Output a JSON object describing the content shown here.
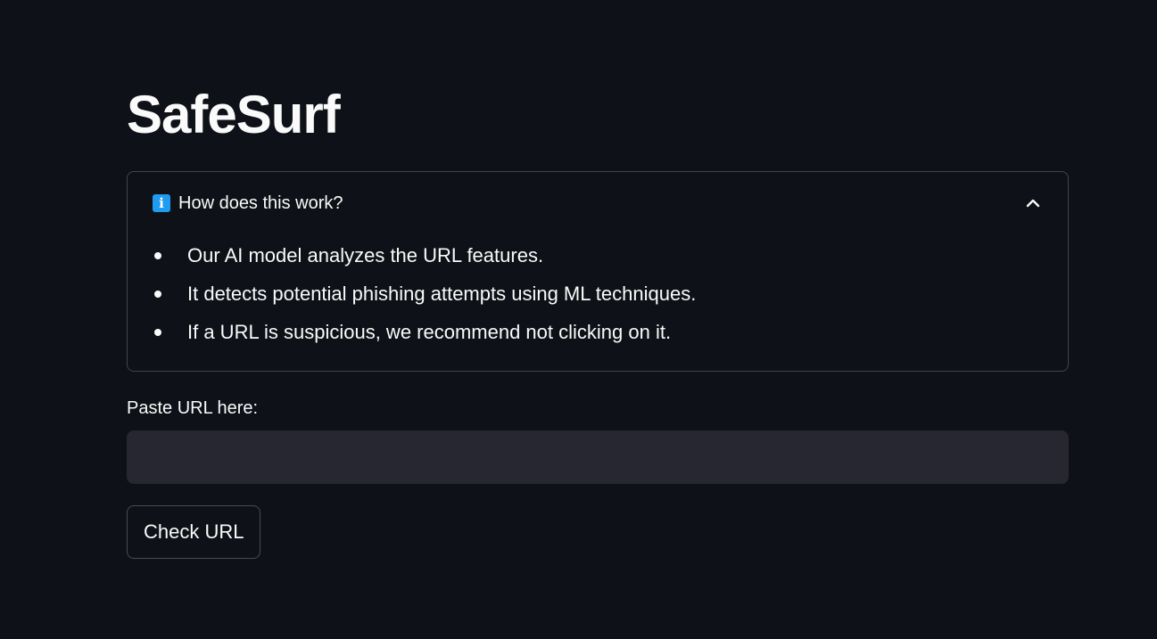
{
  "app": {
    "title": "SafeSurf"
  },
  "expander": {
    "icon": "info-icon",
    "icon_glyph": "i",
    "label": "How does this work?",
    "expanded": true,
    "toggle_icon": "chevron-up-icon",
    "items": [
      {
        "text": "Our AI model analyzes the URL features."
      },
      {
        "text": "It detects potential phishing attempts using ML techniques."
      },
      {
        "text": "If a URL is suspicious, we recommend not clicking on it."
      }
    ]
  },
  "url_field": {
    "label": "Paste URL here:",
    "value": "",
    "placeholder": ""
  },
  "check_button": {
    "label": "Check URL"
  },
  "colors": {
    "background": "#0e1117",
    "input_background": "#262730",
    "text": "#fafafa",
    "info_accent": "#1f9bf0"
  }
}
